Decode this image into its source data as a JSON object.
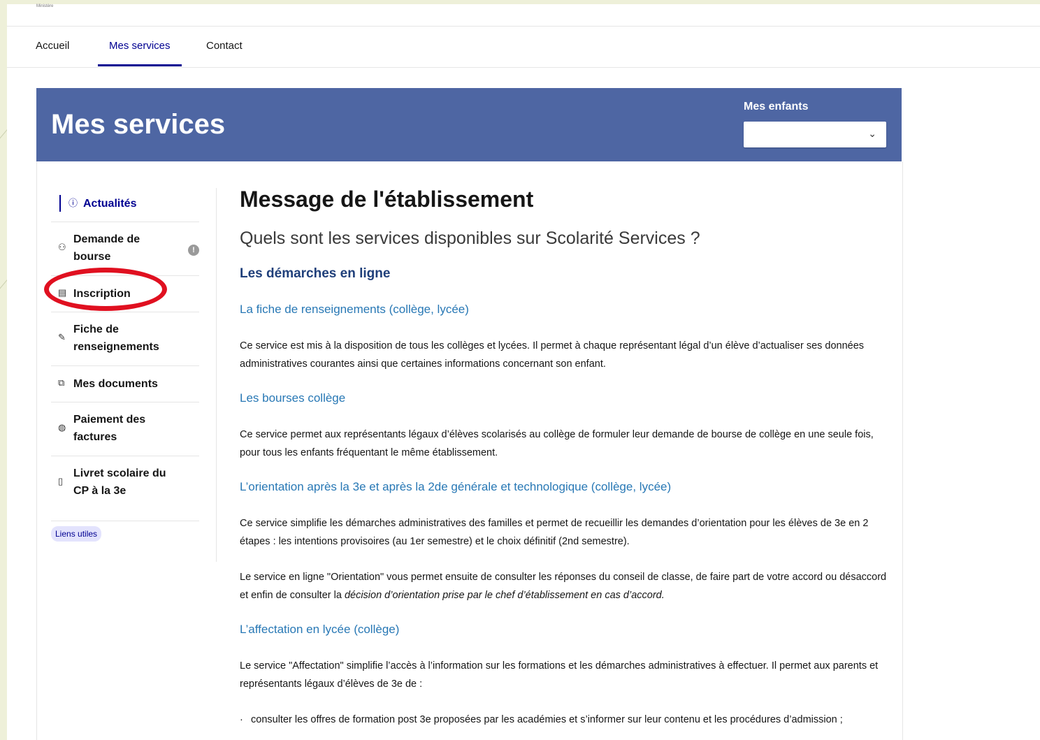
{
  "header": {
    "logo_text": "Ministère"
  },
  "topnav": {
    "items": [
      {
        "label": "Accueil"
      },
      {
        "label": "Mes services"
      },
      {
        "label": "Contact"
      }
    ],
    "active": "Mes services"
  },
  "banner": {
    "title": "Mes services",
    "children_label": "Mes enfants",
    "children_selected": ""
  },
  "sidebar": {
    "items": [
      {
        "label": "Actualités",
        "icon": "info-circle-icon"
      },
      {
        "label": "Demande de bourse",
        "icon": "family-icon"
      },
      {
        "label": "Inscription",
        "icon": "document-icon"
      },
      {
        "label": "Fiche de renseignements",
        "icon": "edit-icon"
      },
      {
        "label": "Mes documents",
        "icon": "files-icon"
      },
      {
        "label": "Paiement des factures",
        "icon": "coin-icon"
      },
      {
        "label": "Livret scolaire du CP à la 3e",
        "icon": "book-icon"
      }
    ],
    "useful_links": "Liens utiles"
  },
  "main": {
    "title": "Message de l'établissement",
    "subtitle": "Quels sont les services disponibles sur Scolarité Services ?",
    "section_title": "Les démarches en ligne",
    "blocks": [
      {
        "link": "La fiche de renseignements (collège, lycée)",
        "text": "Ce service est mis à la disposition de tous les collèges et lycées. Il permet à chaque représentant légal d’un élève d’actualiser ses données administratives courantes ainsi que certaines informations concernant son enfant."
      },
      {
        "link": "Les bourses collège",
        "text": "Ce service permet aux représentants légaux d’élèves scolarisés au collège de formuler leur demande de bourse de collège en une seule fois, pour tous les enfants fréquentant le même établissement."
      },
      {
        "link": "L’orientation après la 3e et après la 2de générale et technologique (collège, lycée)",
        "text": "Ce service simplifie les démarches administratives des familles et permet de recueillir les demandes d’orientation pour les élèves de 3e en 2 étapes : les intentions provisoires (au 1er semestre) et le choix définitif (2nd semestre).",
        "text2_a": "Le service en ligne \"Orientation\" vous permet ensuite de consulter les réponses du conseil de classe, de faire part de votre accord ou désaccord et enfin de consulter la ",
        "text2_b": "décision d’orientation prise par le chef d’établissement en cas d’accord."
      },
      {
        "link": "L’affectation en lycée (collège)",
        "text": "Le service \"Affectation\" simplifie l’accès à l’information sur les formations et les démarches administratives à effectuer. Il permet aux parents et représentants légaux d’élèves de 3e de :",
        "bullet": "consulter les offres de formation post 3e proposées par les académies et s’informer sur leur contenu et les procédures d’admission ;"
      }
    ]
  }
}
